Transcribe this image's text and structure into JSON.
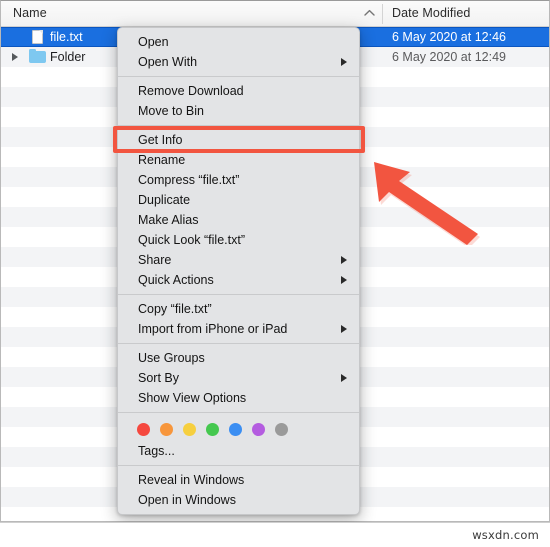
{
  "window": {
    "columns": [
      {
        "label": "Name",
        "sort_indicator": "chevron-up-icon"
      },
      {
        "label": "Date Modified"
      }
    ]
  },
  "file_list": {
    "rows": [
      {
        "name": "file.txt",
        "date_modified": "6 May 2020 at 12:46",
        "icon": "document-icon",
        "selected": true,
        "expandable": false
      },
      {
        "name": "Folder",
        "date_modified": "6 May 2020 at 12:49",
        "icon": "folder-icon",
        "selected": false,
        "expandable": true
      }
    ],
    "empty_row_count": 22
  },
  "context_menu": {
    "groups": [
      {
        "items": [
          {
            "label": "Open",
            "submenu": false
          },
          {
            "label": "Open With",
            "submenu": true
          }
        ]
      },
      {
        "items": [
          {
            "label": "Remove Download",
            "submenu": false
          },
          {
            "label": "Move to Bin",
            "submenu": false
          }
        ]
      },
      {
        "items": [
          {
            "label": "Get Info",
            "submenu": false,
            "highlighted": true
          },
          {
            "label": "Rename",
            "submenu": false
          },
          {
            "label": "Compress “file.txt”",
            "submenu": false
          },
          {
            "label": "Duplicate",
            "submenu": false
          },
          {
            "label": "Make Alias",
            "submenu": false
          },
          {
            "label": "Quick Look “file.txt”",
            "submenu": false
          },
          {
            "label": "Share",
            "submenu": true
          },
          {
            "label": "Quick Actions",
            "submenu": true
          }
        ]
      },
      {
        "items": [
          {
            "label": "Copy “file.txt”",
            "submenu": false
          },
          {
            "label": "Import from iPhone or iPad",
            "submenu": true
          }
        ]
      },
      {
        "items": [
          {
            "label": "Use Groups",
            "submenu": false
          },
          {
            "label": "Sort By",
            "submenu": true
          },
          {
            "label": "Show View Options",
            "submenu": false
          }
        ]
      },
      {
        "tags": {
          "colors": [
            "#f5483f",
            "#f7963c",
            "#f6cf3f",
            "#45c84f",
            "#3b8ef2",
            "#b45ce0",
            "#9a9a9a"
          ],
          "names": [
            "tag-red",
            "tag-orange",
            "tag-yellow",
            "tag-green",
            "tag-blue",
            "tag-purple",
            "tag-grey"
          ],
          "label": "Tags..."
        }
      },
      {
        "items": [
          {
            "label": "Reveal in Windows",
            "submenu": false
          },
          {
            "label": "Open in Windows",
            "submenu": false
          }
        ]
      }
    ]
  },
  "annotation": {
    "highlight_color": "#f25540",
    "arrow_color": "#f25540",
    "highlighted_item": "Get Info"
  },
  "watermark": {
    "text": "wsxdn.com"
  }
}
